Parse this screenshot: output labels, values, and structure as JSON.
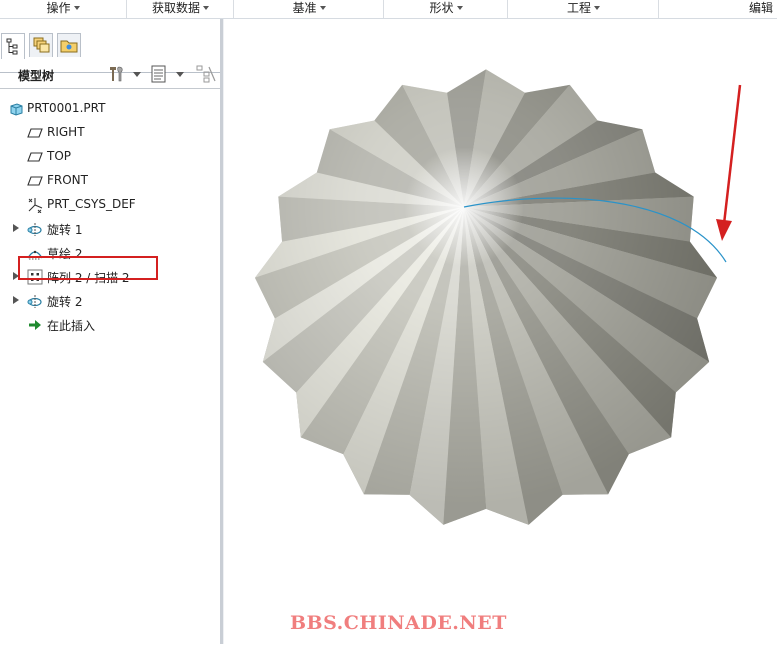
{
  "menu": {
    "groups": [
      {
        "label": "操作"
      },
      {
        "label": "获取数据"
      },
      {
        "label": "基准"
      },
      {
        "label": "形状"
      },
      {
        "label": "工程"
      },
      {
        "label": "编辑"
      }
    ]
  },
  "panel": {
    "title": "模型树"
  },
  "tree": {
    "items": [
      {
        "label": "PRT0001.PRT",
        "icon": "part-icon"
      },
      {
        "label": "RIGHT",
        "icon": "datum-plane-icon"
      },
      {
        "label": "TOP",
        "icon": "datum-plane-icon"
      },
      {
        "label": "FRONT",
        "icon": "datum-plane-icon"
      },
      {
        "label": "PRT_CSYS_DEF",
        "icon": "csys-icon"
      },
      {
        "label": "旋转 1",
        "icon": "revolve-icon"
      },
      {
        "label": "草绘 2",
        "icon": "sketch-icon"
      },
      {
        "label": "阵列 2 / 扫描 2",
        "icon": "pattern-icon"
      },
      {
        "label": "旋转 2",
        "icon": "revolve-icon"
      },
      {
        "label": "在此插入",
        "icon": "insert-here-arrow-icon"
      }
    ]
  },
  "viewport": {
    "watermark": "BBS.CHINADE.NET"
  },
  "colors": {
    "highlight_box": "#d42020",
    "annotation_arrow": "#d42020",
    "sketch_curve": "#2a93c9",
    "model_light": "#f4f4ee",
    "model_dark": "#6e6e66"
  }
}
